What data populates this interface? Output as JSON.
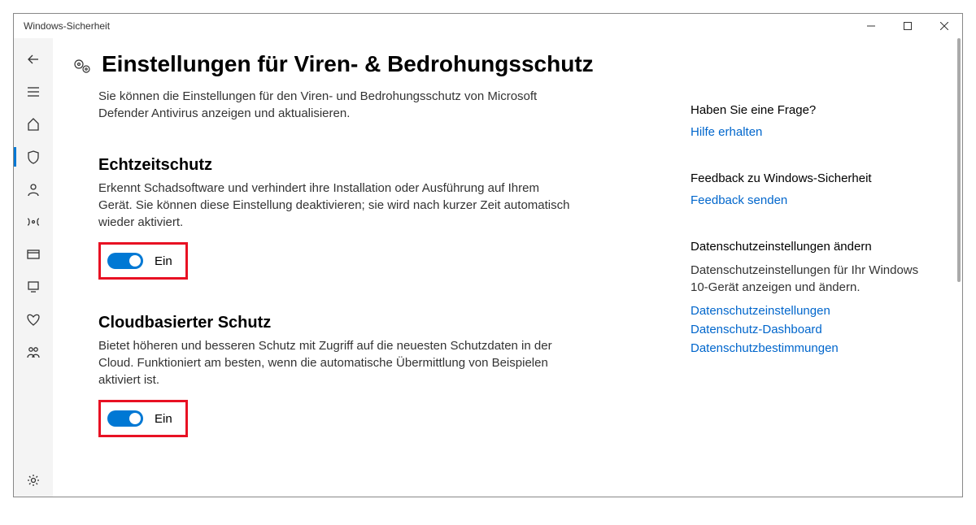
{
  "window": {
    "title": "Windows-Sicherheit"
  },
  "page": {
    "title": "Einstellungen für Viren- & Bedrohungsschutz",
    "description": "Sie können die Einstellungen für den Viren- und Bedrohungsschutz von Microsoft Defender Antivirus anzeigen und aktualisieren."
  },
  "sections": {
    "realtime": {
      "title": "Echtzeitschutz",
      "desc": "Erkennt Schadsoftware und verhindert ihre Installation oder Ausführung auf Ihrem Gerät. Sie können diese Einstellung deaktivieren; sie wird nach kurzer Zeit automatisch wieder aktiviert.",
      "state": "Ein"
    },
    "cloud": {
      "title": "Cloudbasierter Schutz",
      "desc": "Bietet höheren und besseren Schutz mit Zugriff auf die neuesten Schutzdaten in der Cloud. Funktioniert am besten, wenn die automatische Übermittlung von Beispielen aktiviert ist.",
      "state": "Ein"
    }
  },
  "aside": {
    "help": {
      "title": "Haben Sie eine Frage?",
      "link": "Hilfe erhalten"
    },
    "feedback": {
      "title": "Feedback zu Windows-Sicherheit",
      "link": "Feedback senden"
    },
    "privacy": {
      "title": "Datenschutzeinstellungen ändern",
      "desc": "Datenschutzeinstellungen für Ihr Windows 10-Gerät anzeigen und ändern.",
      "link1": "Datenschutzeinstellungen",
      "link2": "Datenschutz-Dashboard",
      "link3": "Datenschutzbestimmungen"
    }
  }
}
